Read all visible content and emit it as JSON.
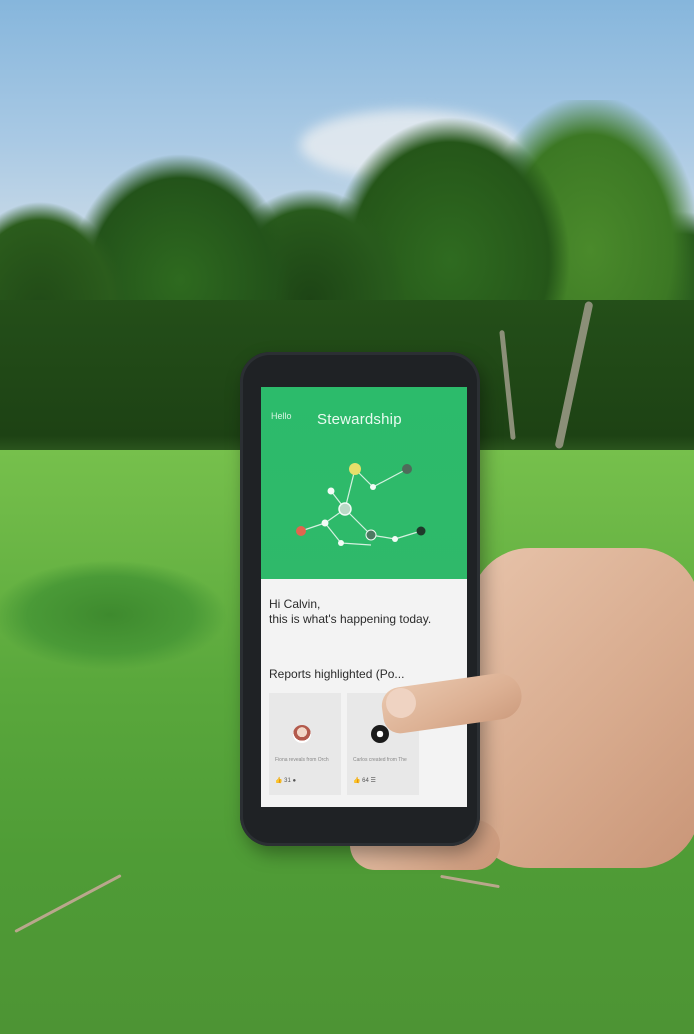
{
  "app": {
    "back_label": "Hello",
    "title": "Stewardship",
    "greeting_line1": "Hi Calvin,",
    "greeting_line2": "this is what's happening today.",
    "section_title": "Reports highlighted (Po..."
  },
  "cards": [
    {
      "caption": "Fiona reveals from Orch",
      "meta": "👍 31 ●"
    },
    {
      "caption": "Carlos created from The",
      "meta": "👍 64 ☰"
    }
  ],
  "colors": {
    "app_green": "#2fb96a",
    "node_yellow": "#e6df6a",
    "node_red": "#e0654e",
    "phone_body": "#1f2225"
  }
}
